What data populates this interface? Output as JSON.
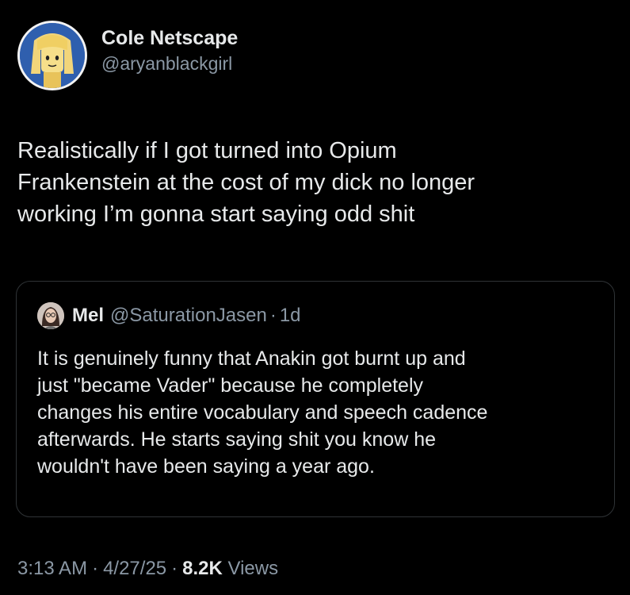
{
  "author": {
    "display_name": "Cole Netscape",
    "handle": "@aryanblackgirl",
    "avatar_icon": "lego-minifigure-avatar"
  },
  "post": {
    "text": "Realistically if I got turned into Opium\nFrankenstein at the cost of my dick no longer\nworking I’m gonna start saying odd shit"
  },
  "quote": {
    "display_name": "Mel",
    "handle": "@SaturationJasen",
    "separator": "·",
    "time": "1d",
    "avatar_icon": "profile-photo-avatar",
    "text": "It is genuinely funny that Anakin got burnt up and\njust \"became Vader\" because he completely\nchanges his entire vocabulary and speech cadence\nafterwards. He starts saying shit you know he\nwouldn't have been saying a year ago."
  },
  "footer": {
    "time": "3:13 AM",
    "sep1": "·",
    "date": "4/27/25",
    "sep2": "·",
    "views_count": "8.2K",
    "views_label": "Views"
  },
  "colors": {
    "background": "#000000",
    "primary_text": "#e7e9ea",
    "secondary_text": "#8b98a5",
    "border": "#2f3336"
  }
}
